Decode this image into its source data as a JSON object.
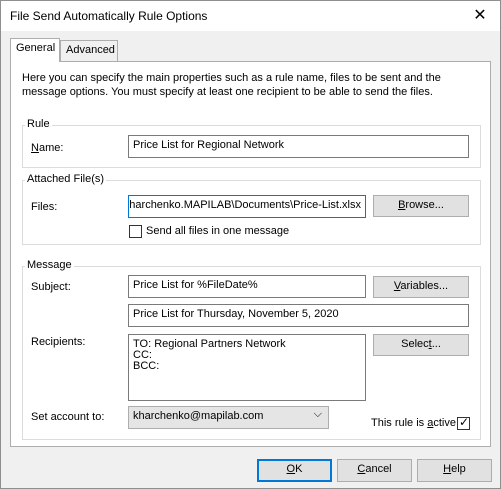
{
  "window": {
    "title": "File Send Automatically Rule Options",
    "close_icon": "close-icon"
  },
  "tabs": [
    {
      "label": "General",
      "active": true
    },
    {
      "label": "Advanced",
      "active": false
    }
  ],
  "intro_text": "Here you can specify the main properties such as a rule name, files to be sent and the message options. You must specify at least one recipient to be able to send the files.",
  "rule": {
    "group_label": "Rule",
    "name_label": "Name:",
    "name_value": "Price List for Regional Network"
  },
  "attached": {
    "group_label": "Attached File(s)",
    "files_label": "Files:",
    "files_value": "\\kharchenko.MAPILAB\\Documents\\Price-List.xlsx",
    "browse_label": "Browse...",
    "send_all_label": "Send all files in one message",
    "send_all_checked": false
  },
  "message": {
    "group_label": "Message",
    "subject_label": "Subject:",
    "subject_value": "Price List for %FileDate%",
    "variables_label": "Variables...",
    "subject_preview": "Price List for Thursday, November 5, 2020",
    "recipients_label": "Recipients:",
    "recipients_value": "TO: Regional Partners Network\nCC:\nBCC:",
    "select_label": "Select...",
    "account_label": "Set account to:",
    "account_value": "kharchenko@mapilab.com",
    "active_label": "This rule is active",
    "active_checked": true
  },
  "footer": {
    "ok_label": "OK",
    "cancel_label": "Cancel",
    "help_label": "Help"
  }
}
